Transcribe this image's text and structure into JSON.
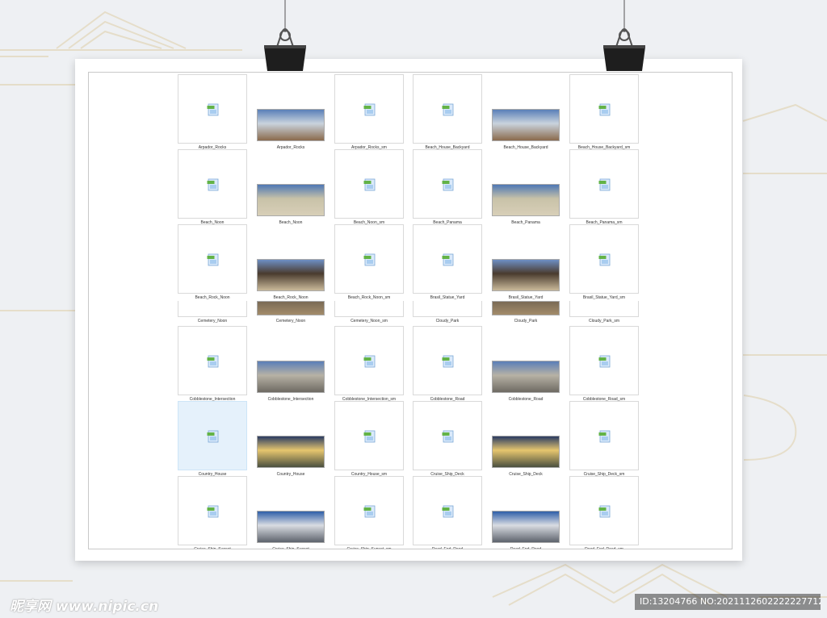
{
  "colors": {
    "background": "#eef0f3",
    "paper": "#ffffff",
    "tile_border": "#d9d9d9",
    "selected_tile": "#e5f1fb",
    "clip": "#222222"
  },
  "file_grid": {
    "selected_file": "Country_House",
    "rows": [
      [
        "Arpador_Rocks",
        "Arpador_Rocks",
        "Arpador_Rocks_sm",
        "Beach_House_Backyard",
        "Beach_House_Backyard",
        "Beach_House_Backyard_sm"
      ],
      [
        "Beach_Noon",
        "Beach_Noon",
        "Beach_Noon_sm",
        "Beach_Panama",
        "Beach_Panama",
        "Beach_Panama_sm"
      ],
      [
        "Beach_Rock_Noon",
        "Beach_Rock_Noon",
        "Beach_Rock_Noon_sm",
        "Brasil_Statue_Yard",
        "Brasil_Statue_Yard",
        "Brasil_Statue_Yard_sm"
      ],
      [
        "Cemetery_Noon",
        "Cemetery_Noon",
        "Cemetery_Noon_sm",
        "Cloudy_Park",
        "Cloudy_Park",
        "Cloudy_Park_sm"
      ],
      [
        "Cobblestone_Intersection",
        "Cobblestone_Intersection",
        "Cobblestone_Intersection_sm",
        "Cobblestone_Road",
        "Cobblestone_Road",
        "Cobblestone_Road_sm"
      ],
      [
        "Country_House",
        "Country_House",
        "Country_House_sm",
        "Cruise_Ship_Deck",
        "Cruise_Ship_Deck",
        "Cruise_Ship_Deck_sm"
      ],
      [
        "Cruise_Ship_Sunset",
        "Cruise_Ship_Sunset",
        "Cruise_Ship_Sunset_sm",
        "Dead_End_Road",
        "Dead_End_Road",
        "Dead_End_Road_sm"
      ]
    ],
    "column_kinds": [
      "file-icon",
      "panorama",
      "file-icon",
      "file-icon",
      "panorama",
      "file-icon"
    ],
    "icon_names": {
      "file-icon": "image-file-icon",
      "panorama": "hdr-panorama-thumbnail"
    }
  },
  "watermark": {
    "logo_text": "昵享网 www.nipic.cn",
    "id_text": "ID:13204766 NO:20211126022222277120"
  }
}
